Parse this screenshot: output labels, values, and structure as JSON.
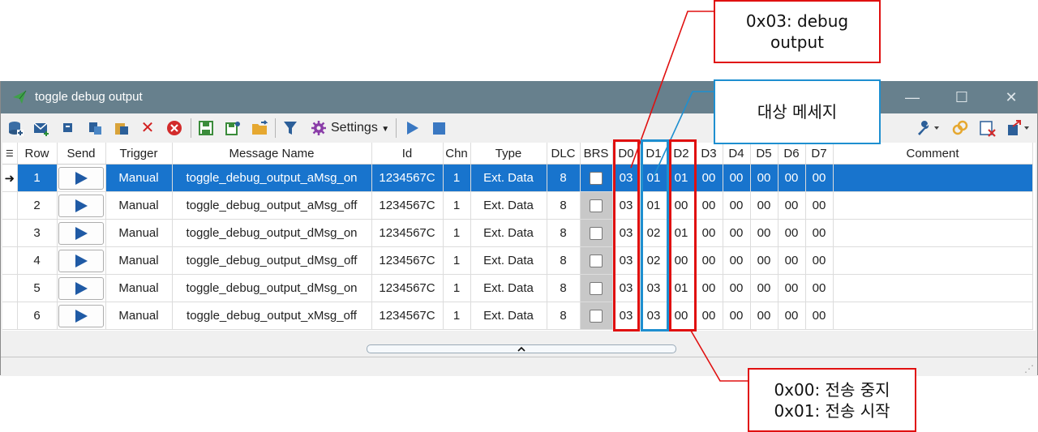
{
  "window": {
    "title": "toggle debug output",
    "minimize_glyph": "—",
    "maximize_glyph": "☐",
    "close_glyph": "✕"
  },
  "toolbar": {
    "settings_label": "Settings",
    "icons": [
      "database-add-icon",
      "new-message-icon",
      "copy-icon",
      "paste-icon",
      "clipboard-icon",
      "delete-icon",
      "clear-icon",
      "save-icon",
      "save-as-icon",
      "open-folder-icon",
      "filter-icon",
      "gear-icon",
      "play-icon",
      "stop-icon",
      "wrench-icon",
      "link-icon",
      "remove-icon",
      "export-icon"
    ]
  },
  "grid": {
    "columns": [
      "Row",
      "Send",
      "Trigger",
      "Message Name",
      "Id",
      "Chn",
      "Type",
      "DLC",
      "BRS",
      "D0",
      "D1",
      "D2",
      "D3",
      "D4",
      "D5",
      "D6",
      "D7",
      "Comment"
    ],
    "rows": [
      {
        "row": "1",
        "trigger": "Manual",
        "name": "toggle_debug_output_aMsg_on",
        "id": "1234567C",
        "chn": "1",
        "type": "Ext. Data",
        "dlc": "8",
        "d": [
          "03",
          "01",
          "01",
          "00",
          "00",
          "00",
          "00",
          "00"
        ],
        "comment": ""
      },
      {
        "row": "2",
        "trigger": "Manual",
        "name": "toggle_debug_output_aMsg_off",
        "id": "1234567C",
        "chn": "1",
        "type": "Ext. Data",
        "dlc": "8",
        "d": [
          "03",
          "01",
          "00",
          "00",
          "00",
          "00",
          "00",
          "00"
        ],
        "comment": ""
      },
      {
        "row": "3",
        "trigger": "Manual",
        "name": "toggle_debug_output_dMsg_on",
        "id": "1234567C",
        "chn": "1",
        "type": "Ext. Data",
        "dlc": "8",
        "d": [
          "03",
          "02",
          "01",
          "00",
          "00",
          "00",
          "00",
          "00"
        ],
        "comment": ""
      },
      {
        "row": "4",
        "trigger": "Manual",
        "name": "toggle_debug_output_dMsg_off",
        "id": "1234567C",
        "chn": "1",
        "type": "Ext. Data",
        "dlc": "8",
        "d": [
          "03",
          "02",
          "00",
          "00",
          "00",
          "00",
          "00",
          "00"
        ],
        "comment": ""
      },
      {
        "row": "5",
        "trigger": "Manual",
        "name": "toggle_debug_output_dMsg_on",
        "id": "1234567C",
        "chn": "1",
        "type": "Ext. Data",
        "dlc": "8",
        "d": [
          "03",
          "03",
          "01",
          "00",
          "00",
          "00",
          "00",
          "00"
        ],
        "comment": ""
      },
      {
        "row": "6",
        "trigger": "Manual",
        "name": "toggle_debug_output_xMsg_off",
        "id": "1234567C",
        "chn": "1",
        "type": "Ext. Data",
        "dlc": "8",
        "d": [
          "03",
          "03",
          "00",
          "00",
          "00",
          "00",
          "00",
          "00"
        ],
        "comment": ""
      }
    ]
  },
  "annotations": {
    "d0_callout": [
      "0x03: debug",
      "output"
    ],
    "d1_callout": [
      "대상 메세지"
    ],
    "d2_callout": [
      "0x00: 전송 중지",
      "0x01: 전송 시작"
    ],
    "colors": {
      "red": "#e01010",
      "blue": "#1e8fd0",
      "selection": "#1874cd",
      "titlebar": "#67808d"
    }
  }
}
